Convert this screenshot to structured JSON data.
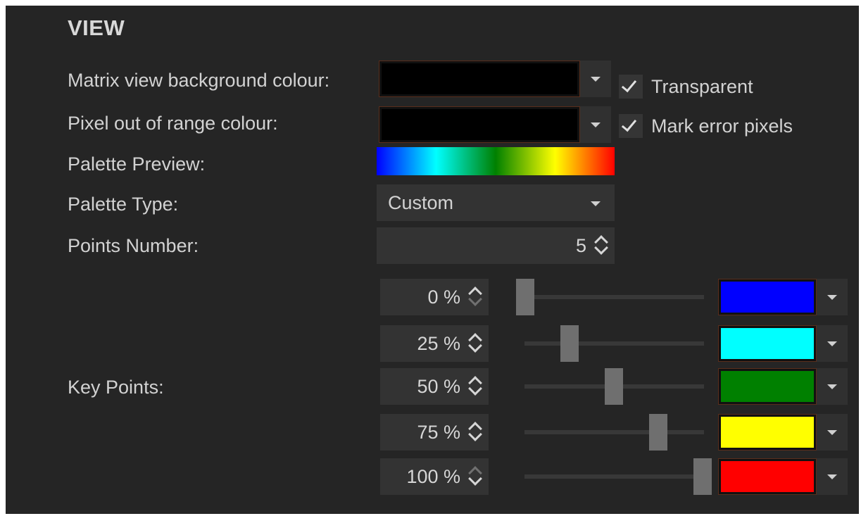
{
  "section": {
    "title": "VIEW"
  },
  "matrix_bg": {
    "label": "Matrix view background colour:",
    "color": "#000000",
    "checkbox_label": "Transparent",
    "checked": true
  },
  "out_of_range": {
    "label": "Pixel out of range colour:",
    "color": "#000000",
    "checkbox_label": "Mark error pixels",
    "checked": true
  },
  "palette_preview": {
    "label": "Palette Preview:",
    "stops": [
      "#0000ff",
      "#00ffff",
      "#008000",
      "#ffff00",
      "#ff0000"
    ]
  },
  "palette_type": {
    "label": "Palette Type:",
    "value": "Custom"
  },
  "points_number": {
    "label": "Points Number:",
    "value": "5"
  },
  "key_points": {
    "label": "Key Points:",
    "points": [
      {
        "percent_text": "0 %",
        "position": 0,
        "color": "#0000ff"
      },
      {
        "percent_text": "25 %",
        "position": 25,
        "color": "#00ffff"
      },
      {
        "percent_text": "50 %",
        "position": 50,
        "color": "#008000"
      },
      {
        "percent_text": "75 %",
        "position": 75,
        "color": "#ffff00"
      },
      {
        "percent_text": "100 %",
        "position": 100,
        "color": "#ff0000"
      }
    ]
  }
}
